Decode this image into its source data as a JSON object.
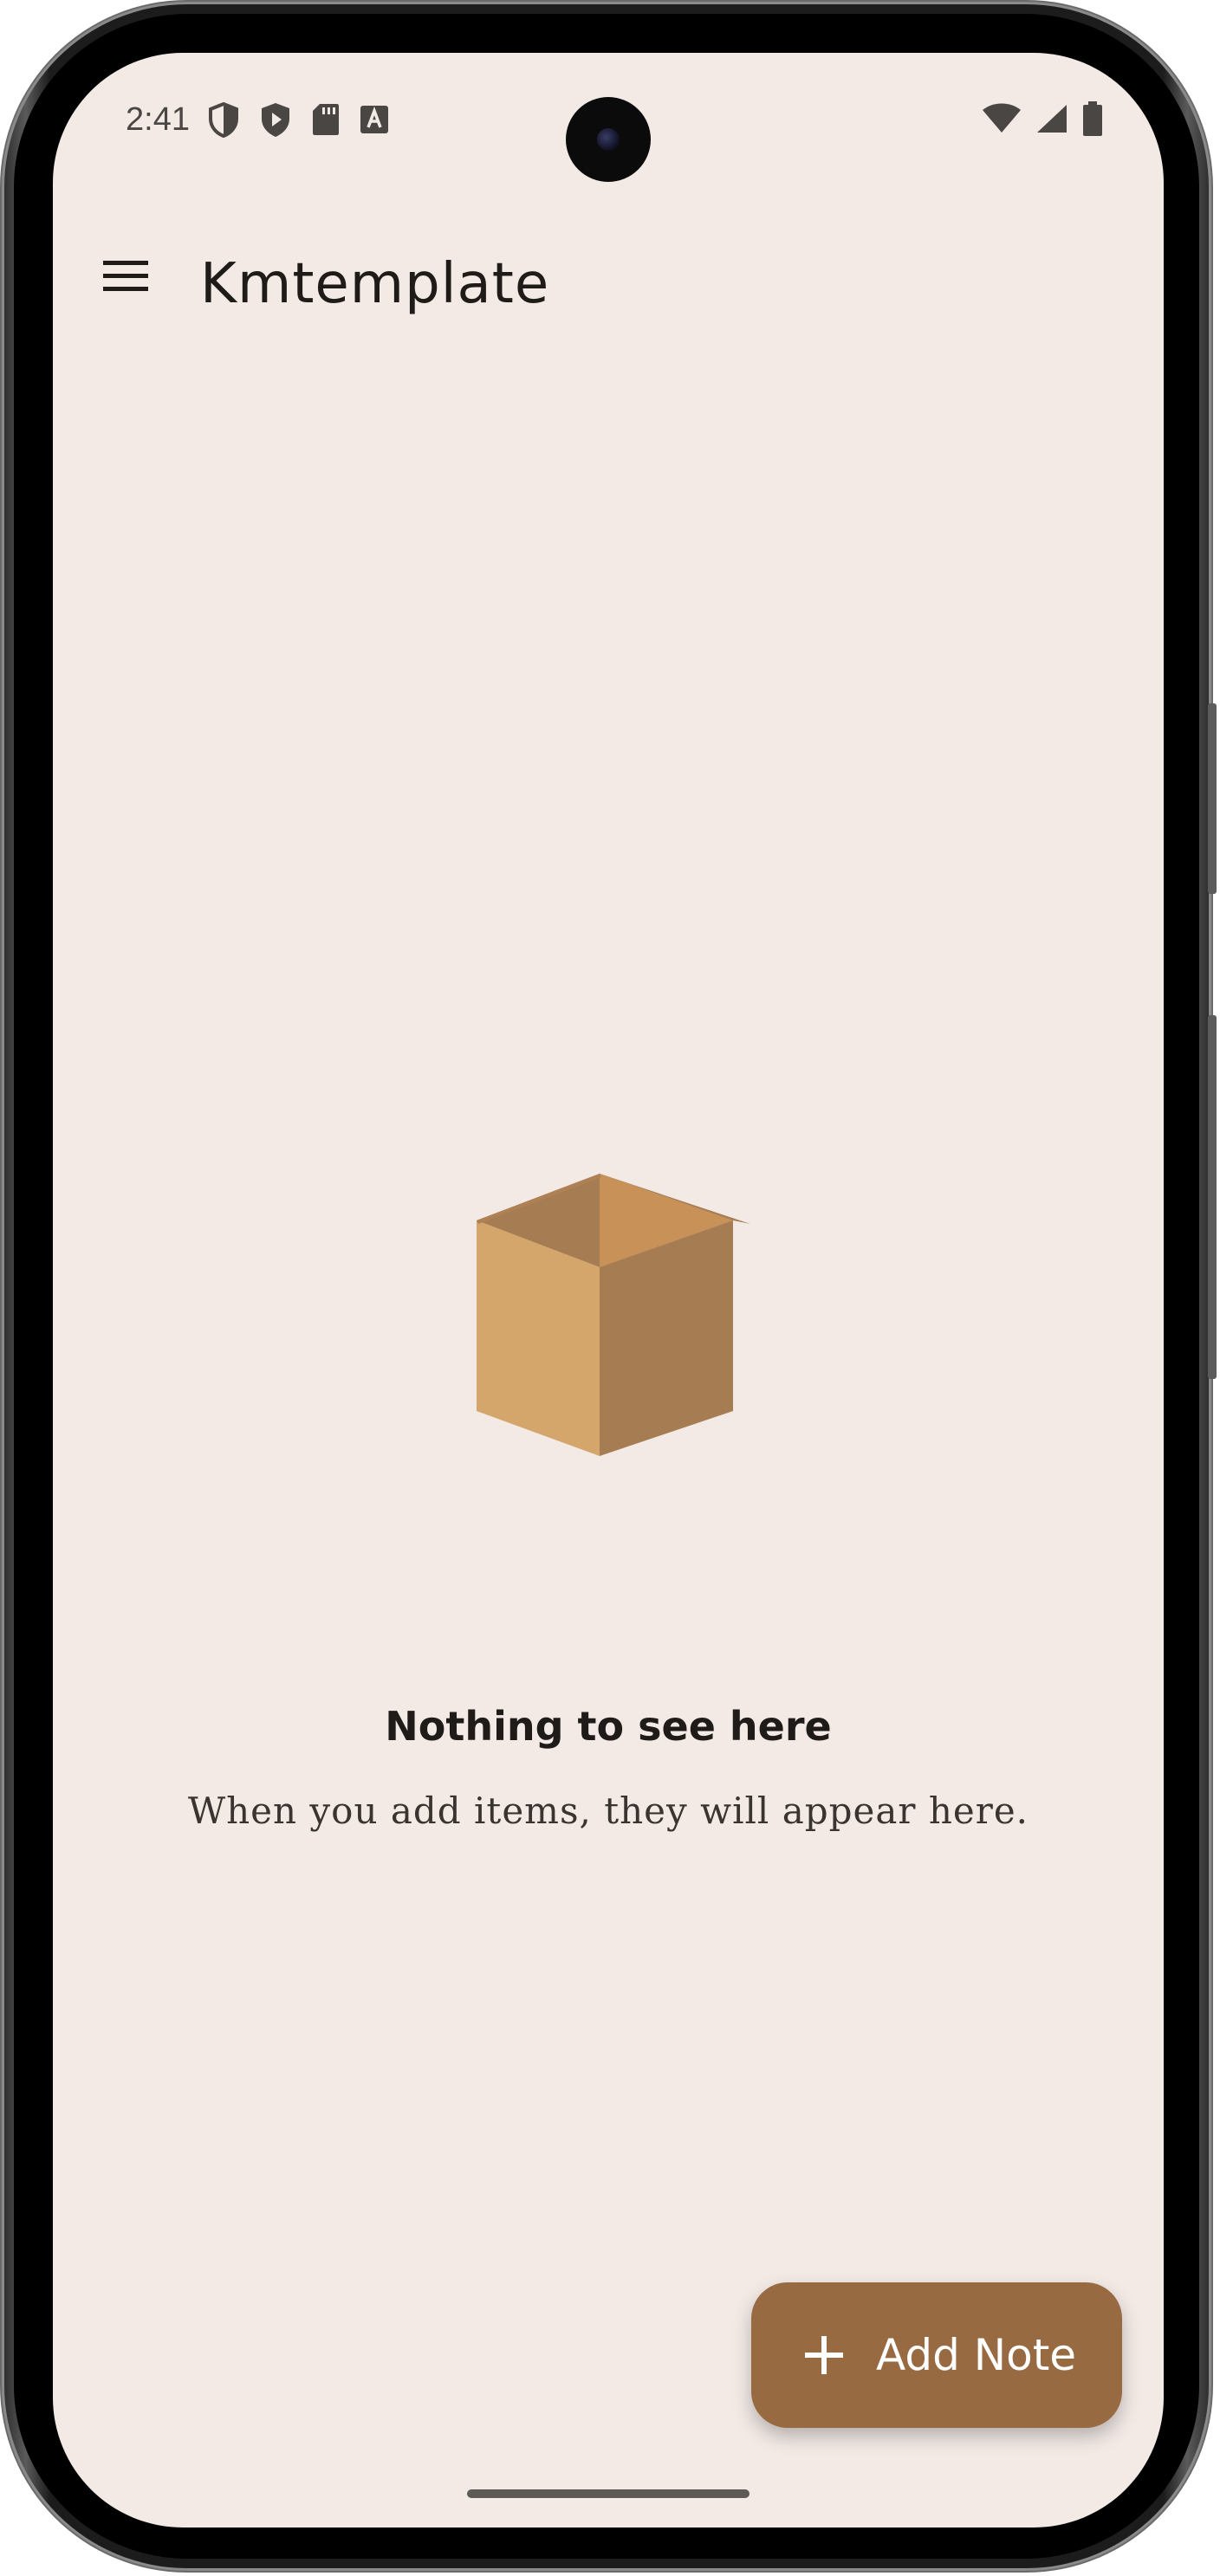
{
  "status_bar": {
    "time": "2:41",
    "left_icons": [
      "vpn-shield-icon",
      "play-protect-icon",
      "sd-card-icon",
      "keyboard-a-icon"
    ],
    "right_icons": [
      "wifi-icon",
      "cellular-signal-icon",
      "battery-icon"
    ]
  },
  "app_bar": {
    "title": "Kmtemplate",
    "menu_icon": "menu-icon"
  },
  "empty_state": {
    "illustration": "open-box-icon",
    "title": "Nothing to see here",
    "subtitle": "When you add items, they will appear here."
  },
  "fab": {
    "icon": "plus-icon",
    "label": "Add Note"
  },
  "colors": {
    "background": "#f3eae6",
    "fab": "#986a42",
    "box_light": "#d4a66b",
    "box_dark": "#a67c52",
    "box_top": "#c79158"
  }
}
